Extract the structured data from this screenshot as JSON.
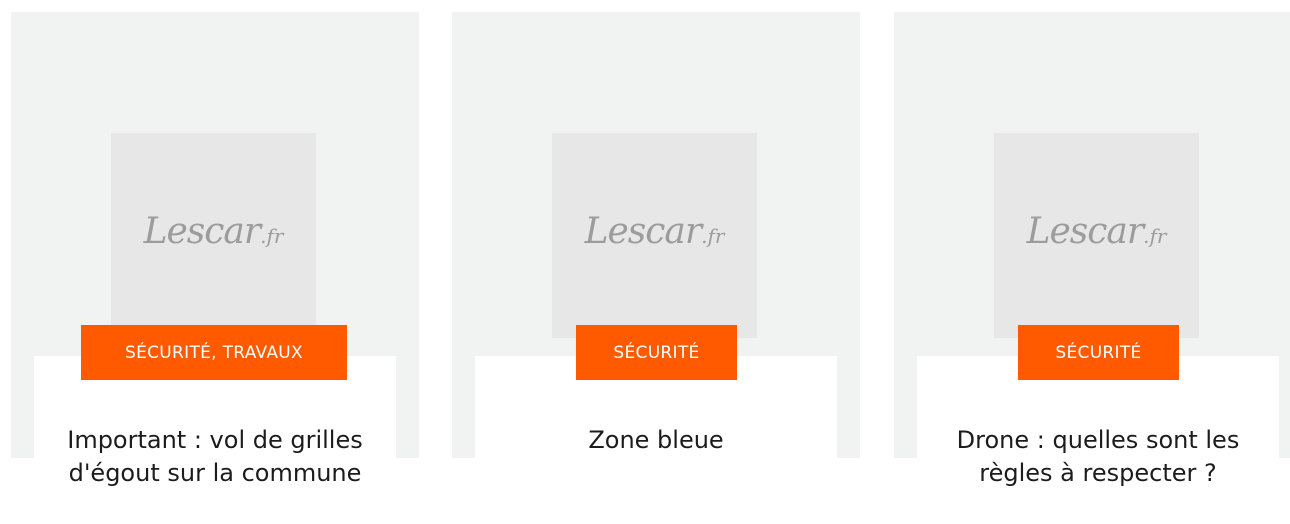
{
  "cards": [
    {
      "logo": "Lescar",
      "logo_tld": ".fr",
      "category": "SÉCURITÉ, TRAVAUX",
      "title": "Important : vol de grilles d'égout sur la commune"
    },
    {
      "logo": "Lescar",
      "logo_tld": ".fr",
      "category": "SÉCURITÉ",
      "title": "Zone bleue"
    },
    {
      "logo": "Lescar",
      "logo_tld": ".fr",
      "category": "SÉCURITÉ",
      "title": "Drone : quelles sont les règles à respecter ?"
    }
  ],
  "colors": {
    "accent": "#ff5a00",
    "card_bg": "#f1f2f2",
    "thumb_bg": "#e7e7e7"
  }
}
